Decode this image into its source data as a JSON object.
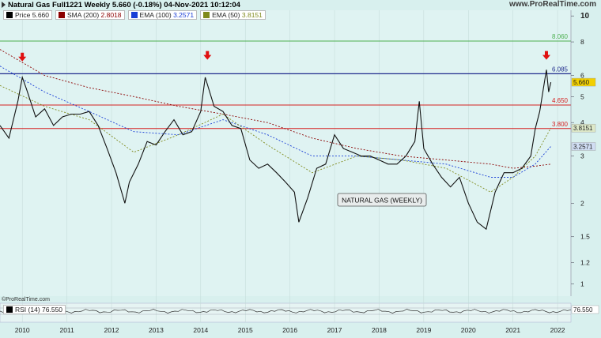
{
  "header": {
    "title": "Natural Gas Full1221 Weekly 5.660 (-0.18%) 04-Nov-2021 10:12:04",
    "logo": "www.ProRealTime.com"
  },
  "legend": [
    {
      "label": "Price 5.660",
      "color": "#000000"
    },
    {
      "label": "SMA (200)",
      "value": "2.8018",
      "color": "#8b0000"
    },
    {
      "label": "EMA (100)",
      "value": "3.2571",
      "color": "#1a3fd6"
    },
    {
      "label": "EMA (50)",
      "value": "3.8151",
      "color": "#7f8a1c"
    }
  ],
  "copyright": "©ProRealTime.com",
  "rsi": {
    "label": "RSI (14)",
    "value": "76.550",
    "axis_label": "76.550"
  },
  "annotation": "NATURAL GAS (WEEKLY)",
  "colors": {
    "background": "#d8f0ee",
    "green_line": "#4caf50",
    "blue_line": "#1f2a8c",
    "red_line": "#d62020",
    "arrow": "#e01010"
  },
  "chart_data": {
    "type": "line",
    "title": "Natural Gas Full1221 Weekly 5.660 (-0.18%) 04-Nov-2021 10:12:04",
    "y_scale": "log",
    "ylim": [
      0.9,
      10.5
    ],
    "y_ticks": [
      1,
      1.2,
      1.5,
      2,
      3,
      4,
      5,
      6,
      8,
      10
    ],
    "x_ticks": [
      "2010",
      "2011",
      "2012",
      "2013",
      "2014",
      "2015",
      "2016",
      "2017",
      "2018",
      "2019",
      "2020",
      "2021",
      "2022"
    ],
    "horizontal_lines": [
      {
        "value": 8.06,
        "label": "8.060",
        "color": "#4caf50"
      },
      {
        "value": 6.085,
        "label": "6.085",
        "color": "#1f2a8c"
      },
      {
        "value": 4.65,
        "label": "4.650",
        "color": "#d62020"
      },
      {
        "value": 3.8,
        "label": "3.800",
        "color": "#d62020"
      }
    ],
    "right_axis_markers": [
      {
        "label": "5.660",
        "value": 5.66,
        "bg": "#f2d000"
      },
      {
        "label": "3.8151",
        "value": 3.8151,
        "bg": "#dde8c8"
      },
      {
        "label": "3.2571",
        "value": 3.2571,
        "bg": "#d0ddf3"
      }
    ],
    "price_series": {
      "x": [
        2009.5,
        2009.7,
        2009.9,
        2010.0,
        2010.1,
        2010.3,
        2010.5,
        2010.7,
        2010.9,
        2011.1,
        2011.3,
        2011.5,
        2011.7,
        2011.9,
        2012.1,
        2012.3,
        2012.4,
        2012.6,
        2012.8,
        2013.0,
        2013.2,
        2013.4,
        2013.6,
        2013.8,
        2014.0,
        2014.1,
        2014.3,
        2014.5,
        2014.7,
        2014.9,
        2015.1,
        2015.3,
        2015.5,
        2015.7,
        2015.9,
        2016.1,
        2016.2,
        2016.4,
        2016.6,
        2016.8,
        2017.0,
        2017.2,
        2017.4,
        2017.6,
        2017.8,
        2018.0,
        2018.2,
        2018.4,
        2018.6,
        2018.8,
        2018.9,
        2019.0,
        2019.2,
        2019.4,
        2019.6,
        2019.8,
        2020.0,
        2020.2,
        2020.4,
        2020.6,
        2020.8,
        2021.0,
        2021.2,
        2021.4,
        2021.5,
        2021.6,
        2021.7,
        2021.75,
        2021.8,
        2021.85
      ],
      "values": [
        3.9,
        3.5,
        4.8,
        5.9,
        5.3,
        4.2,
        4.5,
        3.9,
        4.2,
        4.3,
        4.3,
        4.4,
        3.9,
        3.2,
        2.6,
        2.0,
        2.4,
        2.8,
        3.4,
        3.3,
        3.7,
        4.1,
        3.6,
        3.7,
        4.4,
        5.9,
        4.6,
        4.4,
        3.9,
        3.8,
        2.9,
        2.7,
        2.8,
        2.6,
        2.4,
        2.2,
        1.7,
        2.1,
        2.7,
        2.8,
        3.6,
        3.2,
        3.1,
        3.0,
        3.0,
        2.9,
        2.8,
        2.8,
        3.0,
        3.4,
        4.8,
        3.2,
        2.8,
        2.5,
        2.3,
        2.5,
        2.0,
        1.7,
        1.6,
        2.2,
        2.6,
        2.6,
        2.7,
        3.0,
        3.8,
        4.4,
        5.6,
        6.3,
        5.2,
        5.66
      ]
    },
    "sma200": {
      "x": [
        2009.5,
        2010.5,
        2011.5,
        2012.5,
        2013.5,
        2014.5,
        2015.5,
        2016.5,
        2017.5,
        2018.5,
        2019.5,
        2020.5,
        2021.0,
        2021.5,
        2021.85
      ],
      "values": [
        7.5,
        6.0,
        5.4,
        5.0,
        4.6,
        4.3,
        4.0,
        3.5,
        3.2,
        3.0,
        2.9,
        2.8,
        2.7,
        2.75,
        2.8
      ]
    },
    "ema100": {
      "x": [
        2009.5,
        2010.5,
        2011.5,
        2012.5,
        2013.5,
        2014.5,
        2015.5,
        2016.5,
        2017.5,
        2018.5,
        2019.5,
        2020.5,
        2021.0,
        2021.5,
        2021.85
      ],
      "values": [
        6.5,
        5.2,
        4.4,
        3.7,
        3.6,
        4.1,
        3.6,
        3.0,
        3.0,
        2.9,
        2.8,
        2.5,
        2.5,
        2.8,
        3.26
      ]
    },
    "ema50": {
      "x": [
        2009.5,
        2010.5,
        2011.5,
        2012.5,
        2013.5,
        2014.5,
        2015.5,
        2016.5,
        2017.5,
        2018.5,
        2019.5,
        2020.5,
        2021.0,
        2021.5,
        2021.85
      ],
      "values": [
        5.5,
        4.6,
        4.1,
        3.1,
        3.6,
        4.3,
        3.3,
        2.6,
        3.0,
        2.9,
        2.7,
        2.2,
        2.5,
        3.0,
        3.82
      ]
    },
    "arrows": [
      {
        "x": 2010.0,
        "value": 7.0
      },
      {
        "x": 2014.15,
        "value": 7.1
      },
      {
        "x": 2021.75,
        "value": 7.1
      }
    ]
  }
}
